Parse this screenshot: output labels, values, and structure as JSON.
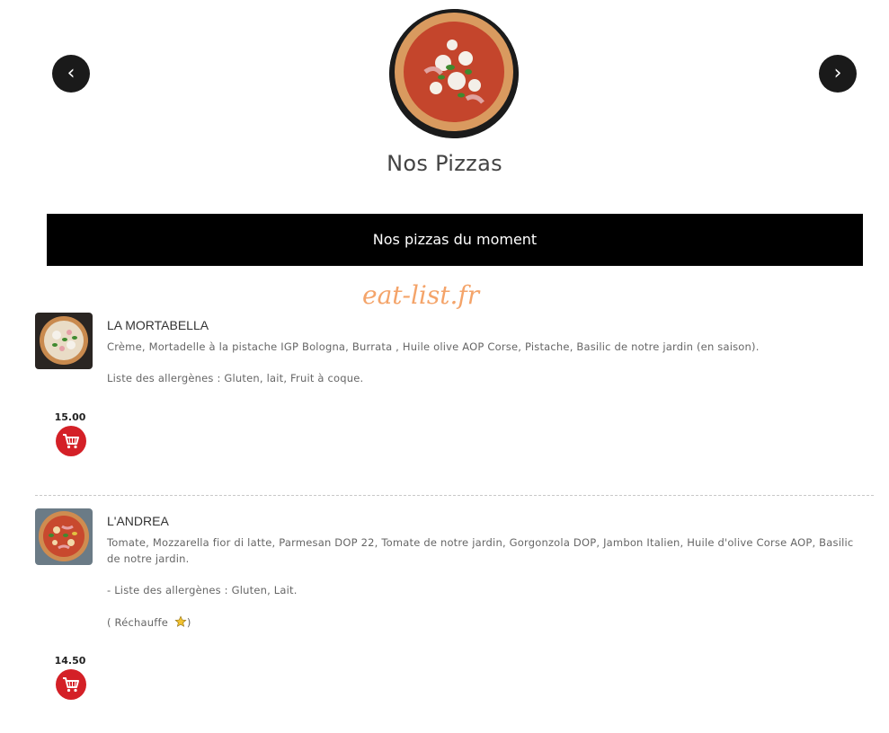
{
  "carousel": {
    "prev_glyph": "‹",
    "next_glyph": "›",
    "title": "Nos Pizzas"
  },
  "category": {
    "title": "Nos pizzas du moment"
  },
  "watermark": "eat-list.fr",
  "items": [
    {
      "name": "LA MORTABELLA",
      "description": "Crème, Mortadelle à la pistache IGP Bologna, Burrata , Huile olive AOP Corse, Pistache, Basilic de notre jardin (en saison).",
      "allergens": "Liste des allergènes : Gluten, lait, Fruit à coque.",
      "price": "15.00",
      "icon": "cart-icon"
    },
    {
      "name": "L'ANDREA",
      "description": "Tomate, Mozzarella fior di latte, Parmesan DOP 22, Tomate de notre jardin, Gorgonzola DOP, Jambon Italien, Huile d'olive Corse AOP, Basilic de notre jardin.",
      "allergens": "- Liste des allergènes : Gluten, Lait.",
      "note": "( Réchauffe",
      "note_end": ")",
      "price": "14.50",
      "icon": "cart-icon"
    }
  ],
  "colors": {
    "cart_button": "#d42027",
    "category_bar": "#000000",
    "watermark": "#f4a46a"
  }
}
